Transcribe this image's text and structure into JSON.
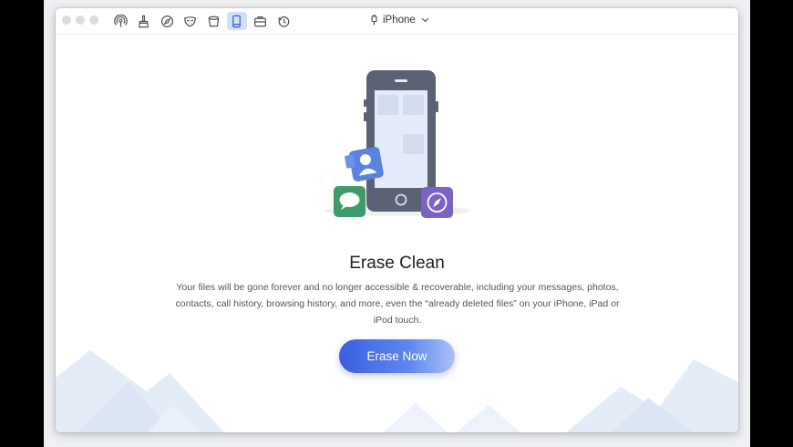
{
  "titlebar": {
    "toolbar": [
      {
        "icon": "podcast-icon"
      },
      {
        "icon": "clean-brush-icon"
      },
      {
        "icon": "browser-safari-icon"
      },
      {
        "icon": "privacy-mask-icon"
      },
      {
        "icon": "trash-bin-icon"
      },
      {
        "icon": "erase-phone-icon",
        "active": true
      },
      {
        "icon": "toolbox-icon"
      },
      {
        "icon": "history-icon"
      }
    ],
    "device_name": "iPhone"
  },
  "main": {
    "title": "Erase Clean",
    "description_lines": [
      "Your files will be gone forever and no longer accessible & recoverable, including your messages, photos,",
      "contacts, call history, browsing history, and more, even the “already deleted files” on your iPhone, iPad or",
      "iPod touch."
    ],
    "button_label": "Erase Now"
  },
  "colors": {
    "accent": "#4a6fe6",
    "active_tab": "#cfe0f7",
    "phone_body": "#5b6275",
    "phone_screen": "#e4ebfa",
    "messages_green": "#3e9c6b",
    "contacts_blue": "#5a83e0",
    "safari_purple": "#7b63c4"
  }
}
